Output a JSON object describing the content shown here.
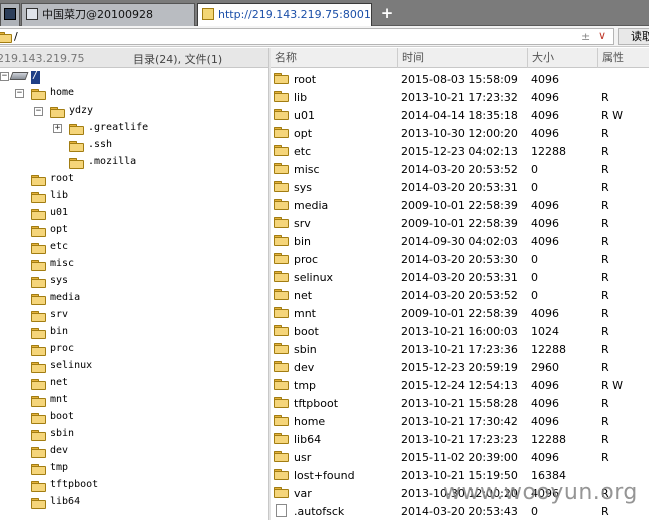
{
  "tabs": [
    {
      "label": ""
    },
    {
      "label": "中国菜刀@20100928"
    },
    {
      "label": "http://219.143.219.75:8001/..."
    }
  ],
  "new_tab_label": "+",
  "address": {
    "path": "/",
    "updown": "±",
    "dropdown": "∨",
    "read_button": "读取"
  },
  "left_header": {
    "ip": "219.143.219.75",
    "counts": "目录(24), 文件(1)"
  },
  "columns": {
    "name": "名称",
    "time": "时间",
    "size": "大小",
    "attr": "属性"
  },
  "tree": {
    "root": "/",
    "home": "home",
    "ydzy": "ydzy",
    "ydzy_children": [
      ".greatlife",
      ".ssh",
      ".mozilla"
    ],
    "top_level": [
      "root",
      "lib",
      "u01",
      "opt",
      "etc",
      "misc",
      "sys",
      "media",
      "srv",
      "bin",
      "proc",
      "selinux",
      "net",
      "mnt",
      "boot",
      "sbin",
      "dev",
      "tmp",
      "tftpboot",
      "lib64"
    ]
  },
  "files": [
    {
      "name": "root",
      "time": "2015-08-03 15:58:09",
      "size": "4096",
      "attr": ""
    },
    {
      "name": "lib",
      "time": "2013-10-21 17:23:32",
      "size": "4096",
      "attr": "R"
    },
    {
      "name": "u01",
      "time": "2014-04-14 18:35:18",
      "size": "4096",
      "attr": "R W"
    },
    {
      "name": "opt",
      "time": "2013-10-30 12:00:20",
      "size": "4096",
      "attr": "R"
    },
    {
      "name": "etc",
      "time": "2015-12-23 04:02:13",
      "size": "12288",
      "attr": "R"
    },
    {
      "name": "misc",
      "time": "2014-03-20 20:53:52",
      "size": "0",
      "attr": "R"
    },
    {
      "name": "sys",
      "time": "2014-03-20 20:53:31",
      "size": "0",
      "attr": "R"
    },
    {
      "name": "media",
      "time": "2009-10-01 22:58:39",
      "size": "4096",
      "attr": "R"
    },
    {
      "name": "srv",
      "time": "2009-10-01 22:58:39",
      "size": "4096",
      "attr": "R"
    },
    {
      "name": "bin",
      "time": "2014-09-30 04:02:03",
      "size": "4096",
      "attr": "R"
    },
    {
      "name": "proc",
      "time": "2014-03-20 20:53:30",
      "size": "0",
      "attr": "R"
    },
    {
      "name": "selinux",
      "time": "2014-03-20 20:53:31",
      "size": "0",
      "attr": "R"
    },
    {
      "name": "net",
      "time": "2014-03-20 20:53:52",
      "size": "0",
      "attr": "R"
    },
    {
      "name": "mnt",
      "time": "2009-10-01 22:58:39",
      "size": "4096",
      "attr": "R"
    },
    {
      "name": "boot",
      "time": "2013-10-21 16:00:03",
      "size": "1024",
      "attr": "R"
    },
    {
      "name": "sbin",
      "time": "2013-10-21 17:23:36",
      "size": "12288",
      "attr": "R"
    },
    {
      "name": "dev",
      "time": "2015-12-23 20:59:19",
      "size": "2960",
      "attr": "R"
    },
    {
      "name": "tmp",
      "time": "2015-12-24 12:54:13",
      "size": "4096",
      "attr": "R W"
    },
    {
      "name": "tftpboot",
      "time": "2013-10-21 15:58:28",
      "size": "4096",
      "attr": "R"
    },
    {
      "name": "home",
      "time": "2013-10-21 17:30:42",
      "size": "4096",
      "attr": "R"
    },
    {
      "name": "lib64",
      "time": "2013-10-21 17:23:23",
      "size": "12288",
      "attr": "R"
    },
    {
      "name": "usr",
      "time": "2015-11-02 20:39:00",
      "size": "4096",
      "attr": "R"
    },
    {
      "name": "lost+found",
      "time": "2013-10-21 15:19:50",
      "size": "16384",
      "attr": ""
    },
    {
      "name": "var",
      "time": "2013-10-30 12:00:20",
      "size": "4096",
      "attr": "R"
    },
    {
      "name": ".autofsck",
      "time": "2014-03-20 20:53:43",
      "size": "0",
      "attr": "R"
    }
  ],
  "watermark": "www.wooyun.org",
  "icons": {
    "folder": "folder-icon",
    "file": "file-icon",
    "drive": "drive-icon",
    "expander": "expand-toggle-icon"
  },
  "colors": {
    "tab_url": "#1b4fa8",
    "selection": "#1e3f86",
    "folder": "#f5d57a",
    "dropdown_arrow": "#c0392b"
  }
}
